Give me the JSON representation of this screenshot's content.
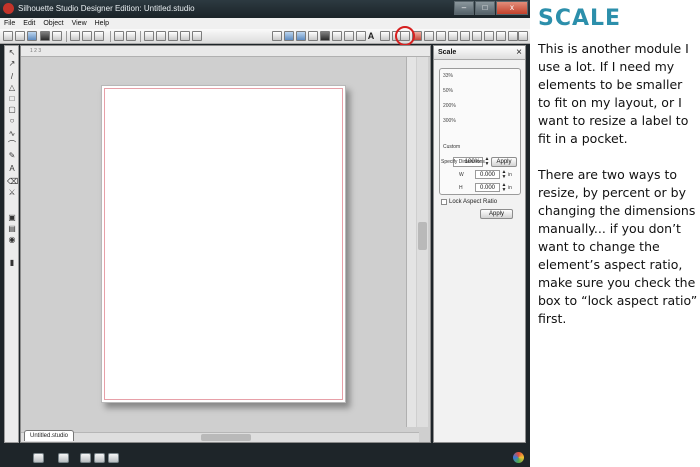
{
  "window": {
    "title": "Silhouette Studio Designer Edition: Untitled.studio",
    "minimize": "–",
    "maximize": "□",
    "close": "x"
  },
  "menu": [
    "File",
    "Edit",
    "Object",
    "View",
    "Help"
  ],
  "toolbar": {
    "text_tool_glyph": "A",
    "highlight_color": "#d62020"
  },
  "document_tab": "Untitled.studio",
  "scale_panel": {
    "title": "Scale",
    "close_glyph": "×",
    "percent_options": [
      "33%",
      "50%",
      "200%",
      "300%"
    ],
    "custom_label": "Custom",
    "custom_value": "100%",
    "apply_label": "Apply",
    "dimensions_label": "Specify Dimensions",
    "width_label": "W",
    "width_value": "0.000",
    "height_label": "H",
    "height_value": "0.000",
    "unit": "in",
    "lock_label": "Lock Aspect Ratio",
    "apply_bottom_label": "Apply"
  },
  "blog": {
    "heading": "SCALE",
    "paragraph_1": "This is another module I use a lot. If I need my elements to be smaller to fit on my layout, or I want to resize a label to fit in a pocket.",
    "paragraph_2": "There are two ways to resize, by percent or by changing the dimensions manually... if you don’t want to change the element’s aspect ratio, make sure you check the box to “lock aspect ratio” first.",
    "accent_color": "#2c8fab"
  }
}
